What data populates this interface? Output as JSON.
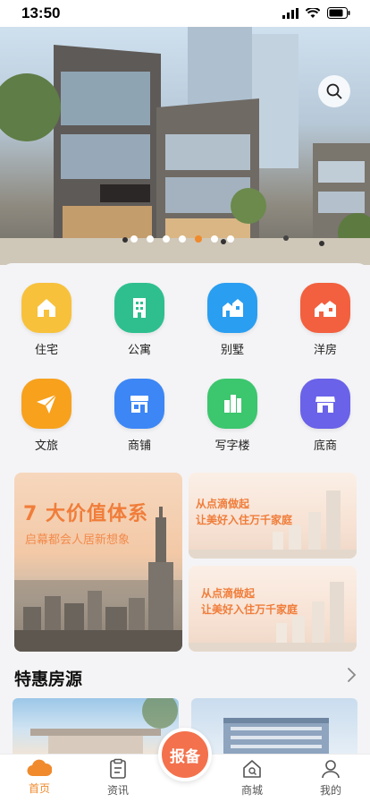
{
  "status_bar": {
    "time": "13:50"
  },
  "hero": {
    "slide_count": 7,
    "active_slide": 5,
    "accent_color": "#f08a2c"
  },
  "categories": [
    {
      "label": "住宅",
      "icon": "house-icon",
      "color": "#f7c13c"
    },
    {
      "label": "公寓",
      "icon": "apartment-icon",
      "color": "#2fbf8f"
    },
    {
      "label": "别墅",
      "icon": "villa-icon",
      "color": "#2a9ef0"
    },
    {
      "label": "洋房",
      "icon": "western-house-icon",
      "color": "#f2603f"
    },
    {
      "label": "文旅",
      "icon": "paper-plane-icon",
      "color": "#f7a11d"
    },
    {
      "label": "商铺",
      "icon": "shop-icon",
      "color": "#3d86f5"
    },
    {
      "label": "写字楼",
      "icon": "office-building-icon",
      "color": "#3cc66e"
    },
    {
      "label": "底商",
      "icon": "storefront-icon",
      "color": "#6a62e8"
    }
  ],
  "promos": {
    "big": {
      "title": "7 大价值体系",
      "subtitle": "启幕都会人居新想象"
    },
    "small": [
      {
        "line1": "从点滴做起",
        "line2": "让美好入住万千家庭"
      },
      {
        "line1": "从点滴做起",
        "line2": "让美好入住万千家庭"
      }
    ]
  },
  "section": {
    "title": "特惠房源"
  },
  "tabbar": {
    "items": [
      {
        "label": "首页",
        "icon": "home-cloud-icon",
        "active": true
      },
      {
        "label": "资讯",
        "icon": "clipboard-icon",
        "active": false
      },
      {
        "label": "商城",
        "icon": "mall-search-icon",
        "active": false
      },
      {
        "label": "我的",
        "icon": "profile-icon",
        "active": false
      }
    ],
    "report_label": "报备",
    "report_color": "#f3714c"
  }
}
